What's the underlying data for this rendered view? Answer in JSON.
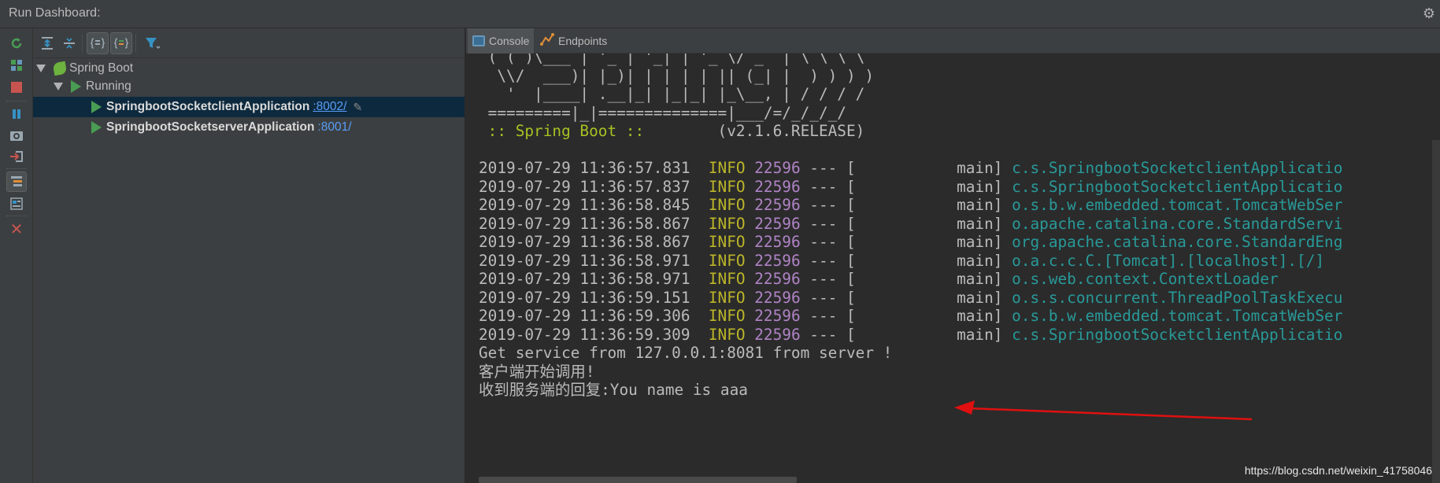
{
  "title": "Run Dashboard:",
  "icons": {
    "settings": "gear-icon"
  },
  "tree": {
    "root_label": "Spring Boot",
    "group_label": "Running",
    "apps": [
      {
        "name": "SpringbootSocketclientApplication",
        "port": ":8002/"
      },
      {
        "name": "SpringbootSocketserverApplication",
        "port": ":8001/"
      }
    ]
  },
  "tabs": {
    "console": "Console",
    "endpoints": "Endpoints"
  },
  "console": {
    "banner": [
      " ( ( )\\___ | '_ | '_| | '_ \\/ _` | \\ \\ \\ \\",
      "  \\\\/  ___)| |_)| | | | | || (_| |  ) ) ) )",
      "   '  |____| .__|_| |_|_| |_\\__, | / / / /",
      " =========|_|==============|___/=/_/_/_/"
    ],
    "spring_boot_label": " :: Spring Boot ::",
    "spring_boot_version": "        (v2.1.6.RELEASE)",
    "log_lines": [
      {
        "ts": "2019-07-29 11:36:57.831",
        "level": "INFO",
        "pid": "22596",
        "thread": "main",
        "logger": "c.s.SpringbootSocketclientApplicatio"
      },
      {
        "ts": "2019-07-29 11:36:57.837",
        "level": "INFO",
        "pid": "22596",
        "thread": "main",
        "logger": "c.s.SpringbootSocketclientApplicatio"
      },
      {
        "ts": "2019-07-29 11:36:58.845",
        "level": "INFO",
        "pid": "22596",
        "thread": "main",
        "logger": "o.s.b.w.embedded.tomcat.TomcatWebSer"
      },
      {
        "ts": "2019-07-29 11:36:58.867",
        "level": "INFO",
        "pid": "22596",
        "thread": "main",
        "logger": "o.apache.catalina.core.StandardServi"
      },
      {
        "ts": "2019-07-29 11:36:58.867",
        "level": "INFO",
        "pid": "22596",
        "thread": "main",
        "logger": "org.apache.catalina.core.StandardEng"
      },
      {
        "ts": "2019-07-29 11:36:58.971",
        "level": "INFO",
        "pid": "22596",
        "thread": "main",
        "logger": "o.a.c.c.C.[Tomcat].[localhost].[/]"
      },
      {
        "ts": "2019-07-29 11:36:58.971",
        "level": "INFO",
        "pid": "22596",
        "thread": "main",
        "logger": "o.s.web.context.ContextLoader"
      },
      {
        "ts": "2019-07-29 11:36:59.151",
        "level": "INFO",
        "pid": "22596",
        "thread": "main",
        "logger": "o.s.s.concurrent.ThreadPoolTaskExecu"
      },
      {
        "ts": "2019-07-29 11:36:59.306",
        "level": "INFO",
        "pid": "22596",
        "thread": "main",
        "logger": "o.s.b.w.embedded.tomcat.TomcatWebSer"
      },
      {
        "ts": "2019-07-29 11:36:59.309",
        "level": "INFO",
        "pid": "22596",
        "thread": "main",
        "logger": "c.s.SpringbootSocketclientApplicatio"
      }
    ],
    "output": [
      "Get service from 127.0.0.1:8081 from server !",
      "客户端开始调用!",
      "收到服务端的回复:You name is aaa"
    ]
  },
  "watermark": "https://blog.csdn.net/weixin_41758046",
  "colors": {
    "info": "#bbb529",
    "pid": "#b083c6",
    "logger": "#299999",
    "run_green": "#499c54",
    "annotation_arrow": "#e01010"
  }
}
